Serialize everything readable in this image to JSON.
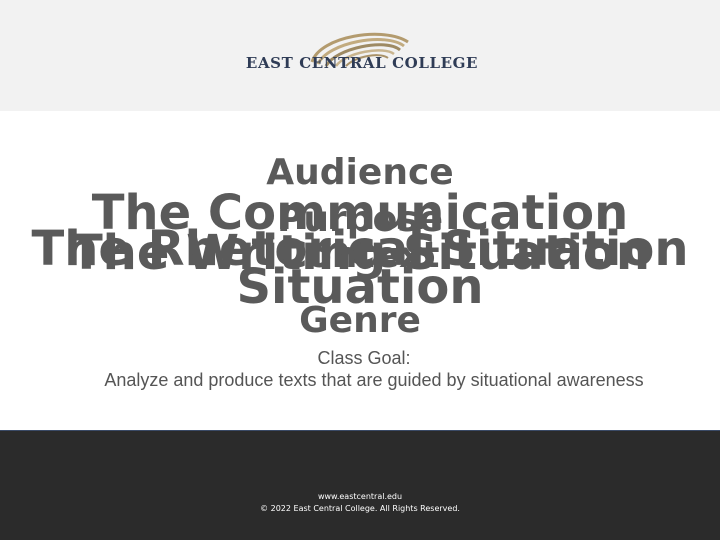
{
  "header": {
    "logo_text": "EAST CENTRAL COLLEGE",
    "colors": {
      "background": "#f2f2f2",
      "logo_text": "#2f3c56",
      "swoosh": "#b39b6e"
    }
  },
  "slide": {
    "title_layers": [
      "The Communication",
      "The Rhetorical Situation",
      "The Writing Situation",
      "Situation"
    ],
    "stack": [
      "Audience",
      "Purpose",
      "Context",
      "Genre"
    ],
    "goal_label": "Class Goal:",
    "goal_text": "Analyze and produce texts that are guided by situational awareness",
    "colors": {
      "text": "#5a5a5a"
    }
  },
  "footer": {
    "url": "www.eastcentral.edu",
    "copyright": "© 2022 East Central College. All Rights Reserved.",
    "colors": {
      "background": "#2b2b2b",
      "text": "#ffffff"
    }
  }
}
